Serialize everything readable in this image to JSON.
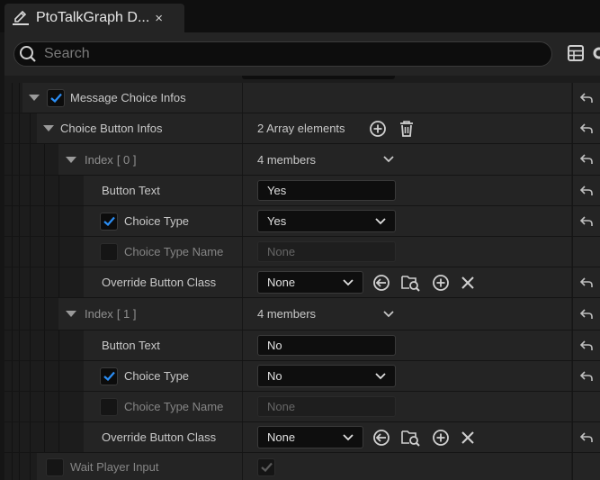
{
  "tab": {
    "title": "PtoTalkGraph D...",
    "close_glyph": "×"
  },
  "search": {
    "placeholder": "Search",
    "value": ""
  },
  "toolbar": {
    "icons": [
      "table-view-icon",
      "settings-icon"
    ]
  },
  "colors": {
    "accent": "#2b8ef5",
    "panel": "#242424",
    "background": "#1c1c1c"
  },
  "properties": {
    "message_choice_infos": {
      "label": "Message Choice Infos",
      "checked": true
    },
    "choice_button_infos": {
      "label": "Choice Button Infos",
      "value": "2 Array elements"
    },
    "index0": {
      "label": "Index",
      "number": "[ 0 ]",
      "members": "4 members",
      "button_text": {
        "label": "Button Text",
        "value": "Yes"
      },
      "choice_type": {
        "label": "Choice Type",
        "value": "Yes",
        "checked": true
      },
      "choice_type_name": {
        "label": "Choice Type Name",
        "value": "None"
      },
      "override_button_class": {
        "label": "Override Button Class",
        "value": "None"
      }
    },
    "index1": {
      "label": "Index",
      "number": "[ 1 ]",
      "members": "4 members",
      "button_text": {
        "label": "Button Text",
        "value": "No"
      },
      "choice_type": {
        "label": "Choice Type",
        "value": "No",
        "checked": true
      },
      "choice_type_name": {
        "label": "Choice Type Name",
        "value": "None"
      },
      "override_button_class": {
        "label": "Override Button Class",
        "value": "None"
      }
    },
    "wait_player_input": {
      "label": "Wait Player Input",
      "checked": true
    }
  }
}
